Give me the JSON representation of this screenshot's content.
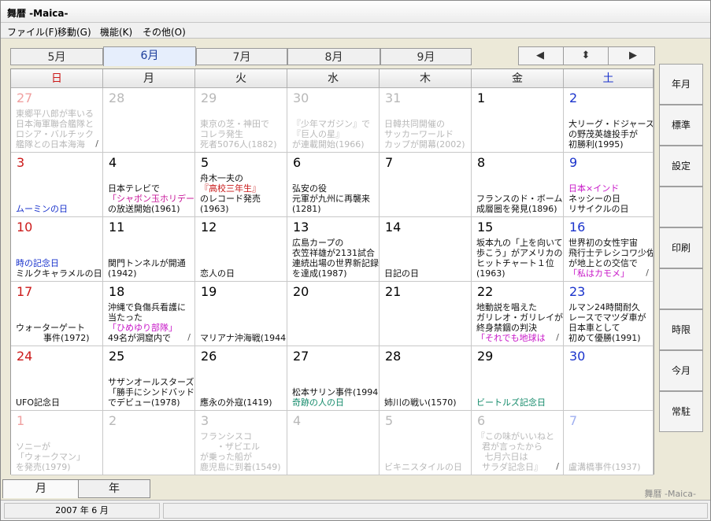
{
  "window": {
    "title": "舞暦 -Maica-"
  },
  "menu": [
    "ファイル(F)",
    "移動(G)",
    "機能(K)",
    "その他(O)"
  ],
  "month_tabs": [
    {
      "label": "5月",
      "active": false
    },
    {
      "label": "6月",
      "active": true
    },
    {
      "label": "7月",
      "active": false
    },
    {
      "label": "8月",
      "active": false
    },
    {
      "label": "9月",
      "active": false
    }
  ],
  "nav": {
    "prev": "◀",
    "updown": "⬍",
    "next": "▶"
  },
  "weekdays": [
    "日",
    "月",
    "火",
    "水",
    "木",
    "金",
    "土"
  ],
  "weeks": [
    [
      {
        "day": "27",
        "dim": true,
        "lines": [
          "東郷平八郎が率いる",
          "日本海軍聯合艦隊と",
          "ロシア・バルチック",
          "艦隊との日本海海"
        ],
        "slash": true
      },
      {
        "day": "28",
        "dim": true,
        "lines": []
      },
      {
        "day": "29",
        "dim": true,
        "lines": [
          "東京の芝・神田で",
          "コレラ発生",
          "死者5076人(1882)"
        ]
      },
      {
        "day": "30",
        "dim": true,
        "lines": [
          "『少年マガジン』で",
          "『巨人の星』",
          "が連載開始(1966)"
        ]
      },
      {
        "day": "31",
        "dim": true,
        "lines": [
          "日韓共同開催の",
          "サッカーワールド",
          "カップが開幕(2002)"
        ]
      },
      {
        "day": "1",
        "dim": false,
        "lines": []
      },
      {
        "day": "2",
        "dim": false,
        "lines": [
          "大リーグ・ドジャース",
          "の野茂英雄投手が",
          "初勝利(1995)"
        ]
      }
    ],
    [
      {
        "day": "3",
        "dim": false,
        "lines": [
          "ムーミンの日"
        ],
        "color": "#1a33cc"
      },
      {
        "day": "4",
        "dim": false,
        "lines": [
          "日本テレビで",
          "「シャボン玉ホリデー」",
          "の放送開始(1961)"
        ],
        "hl": 1,
        "hlcolor": "#c8189a"
      },
      {
        "day": "5",
        "dim": false,
        "lines": [
          "舟木一夫の",
          "『高校三年生』",
          "のレコード発売",
          "(1963)"
        ],
        "hl": 1,
        "hlcolor": "#c81818"
      },
      {
        "day": "6",
        "dim": false,
        "lines": [
          "弘安の役",
          "元軍が九州に再襲来",
          "(1281)"
        ]
      },
      {
        "day": "7",
        "dim": false,
        "lines": []
      },
      {
        "day": "8",
        "dim": false,
        "lines": [
          "フランスのド・ボーム",
          "成層圏を発見(1896)"
        ]
      },
      {
        "day": "9",
        "dim": false,
        "lines": [
          "日本×インド",
          "ネッシーの日",
          "リサイクルの日"
        ],
        "hl": 0,
        "hlcolor": "#c818c8"
      }
    ],
    [
      {
        "day": "10",
        "dim": false,
        "lines": [
          "時の記念日",
          "ミルクキャラメルの日"
        ],
        "hl": 0,
        "hlcolor": "#1a33cc"
      },
      {
        "day": "11",
        "dim": false,
        "lines": [
          "関門トンネルが開通",
          "(1942)"
        ]
      },
      {
        "day": "12",
        "dim": false,
        "lines": [
          "恋人の日"
        ]
      },
      {
        "day": "13",
        "dim": false,
        "lines": [
          "広島カープの",
          "衣笠祥雄が2131試合",
          "連続出場の世界新記録",
          "を達成(1987)"
        ]
      },
      {
        "day": "14",
        "dim": false,
        "lines": [
          "日記の日"
        ]
      },
      {
        "day": "15",
        "dim": false,
        "lines": [
          "坂本九の「上を向いて",
          "歩こう」がアメリカの",
          "ヒットチャート１位",
          "(1963)"
        ]
      },
      {
        "day": "16",
        "dim": false,
        "lines": [
          "世界初の女性宇宙",
          "飛行士テレシコワ少佐",
          "が地上との交信で",
          "「私はカモメ」"
        ],
        "hl": 3,
        "hlcolor": "#c818c8",
        "slash": true
      }
    ],
    [
      {
        "day": "17",
        "dim": false,
        "lines": [
          "ウォーターゲート",
          "          事件(1972)"
        ]
      },
      {
        "day": "18",
        "dim": false,
        "lines": [
          "沖縄で負傷兵看護に",
          "当たった",
          "「ひめゆり部隊」",
          "49名が洞窟内で"
        ],
        "hl": 2,
        "hlcolor": "#c818c8",
        "slash": true
      },
      {
        "day": "19",
        "dim": false,
        "lines": [
          "マリアナ沖海戦(1944)"
        ]
      },
      {
        "day": "20",
        "dim": false,
        "lines": []
      },
      {
        "day": "21",
        "dim": false,
        "lines": []
      },
      {
        "day": "22",
        "dim": false,
        "lines": [
          "地動説を唱えた",
          "ガリレオ・ガリレイが",
          "終身禁錮の判決",
          "「それでも地球は"
        ],
        "hl": 3,
        "hlcolor": "#c818c8",
        "slash": true
      },
      {
        "day": "23",
        "dim": false,
        "lines": [
          "ルマン24時間耐久",
          "レースでマツダ車が",
          "日本車として",
          "初めて優勝(1991)"
        ]
      }
    ],
    [
      {
        "day": "24",
        "dim": false,
        "lines": [
          "UFO記念日"
        ]
      },
      {
        "day": "25",
        "dim": false,
        "lines": [
          "サザンオールスターズ",
          "「勝手にシンドバッド」",
          "でデビュー(1978)"
        ]
      },
      {
        "day": "26",
        "dim": false,
        "lines": [
          "應永の外寇(1419)"
        ]
      },
      {
        "day": "27",
        "dim": false,
        "lines": [
          "松本サリン事件(1994)",
          "奇跡の人の日"
        ],
        "hl": 1,
        "hlcolor": "#138a6a"
      },
      {
        "day": "28",
        "dim": false,
        "lines": [
          "姉川の戦い(1570)"
        ]
      },
      {
        "day": "29",
        "dim": false,
        "lines": [
          "ビートルズ記念日"
        ],
        "hl": 0,
        "hlcolor": "#138a6a"
      },
      {
        "day": "30",
        "dim": false,
        "lines": []
      }
    ],
    [
      {
        "day": "1",
        "dim": true,
        "lines": [
          "ソニーが",
          "「ウォークマン」",
          "を発売(1979)"
        ]
      },
      {
        "day": "2",
        "dim": true,
        "lines": []
      },
      {
        "day": "3",
        "dim": true,
        "lines": [
          "フランシスコ",
          "      ・ザビエル",
          "が乗った船が",
          "鹿児島に到着(1549)"
        ]
      },
      {
        "day": "4",
        "dim": true,
        "lines": []
      },
      {
        "day": "5",
        "dim": true,
        "lines": [
          "ビキニスタイルの日"
        ]
      },
      {
        "day": "6",
        "dim": true,
        "lines": [
          "『この味がいいねと",
          "  君が言ったから",
          "   七月六日は",
          "  サラダ記念日』"
        ],
        "slash": true
      },
      {
        "day": "7",
        "dim": true,
        "lines": [
          "盧溝橋事件(1937)"
        ]
      }
    ]
  ],
  "sidebar": [
    "年月",
    "標準",
    "設定",
    "",
    "印刷",
    "",
    "時限",
    "今月",
    "常駐"
  ],
  "bottom_tabs": [
    {
      "label": "月",
      "active": true
    },
    {
      "label": "年",
      "active": false
    }
  ],
  "status": {
    "date": "2007 年 6 月"
  },
  "brand": "舞暦 -Maica-"
}
